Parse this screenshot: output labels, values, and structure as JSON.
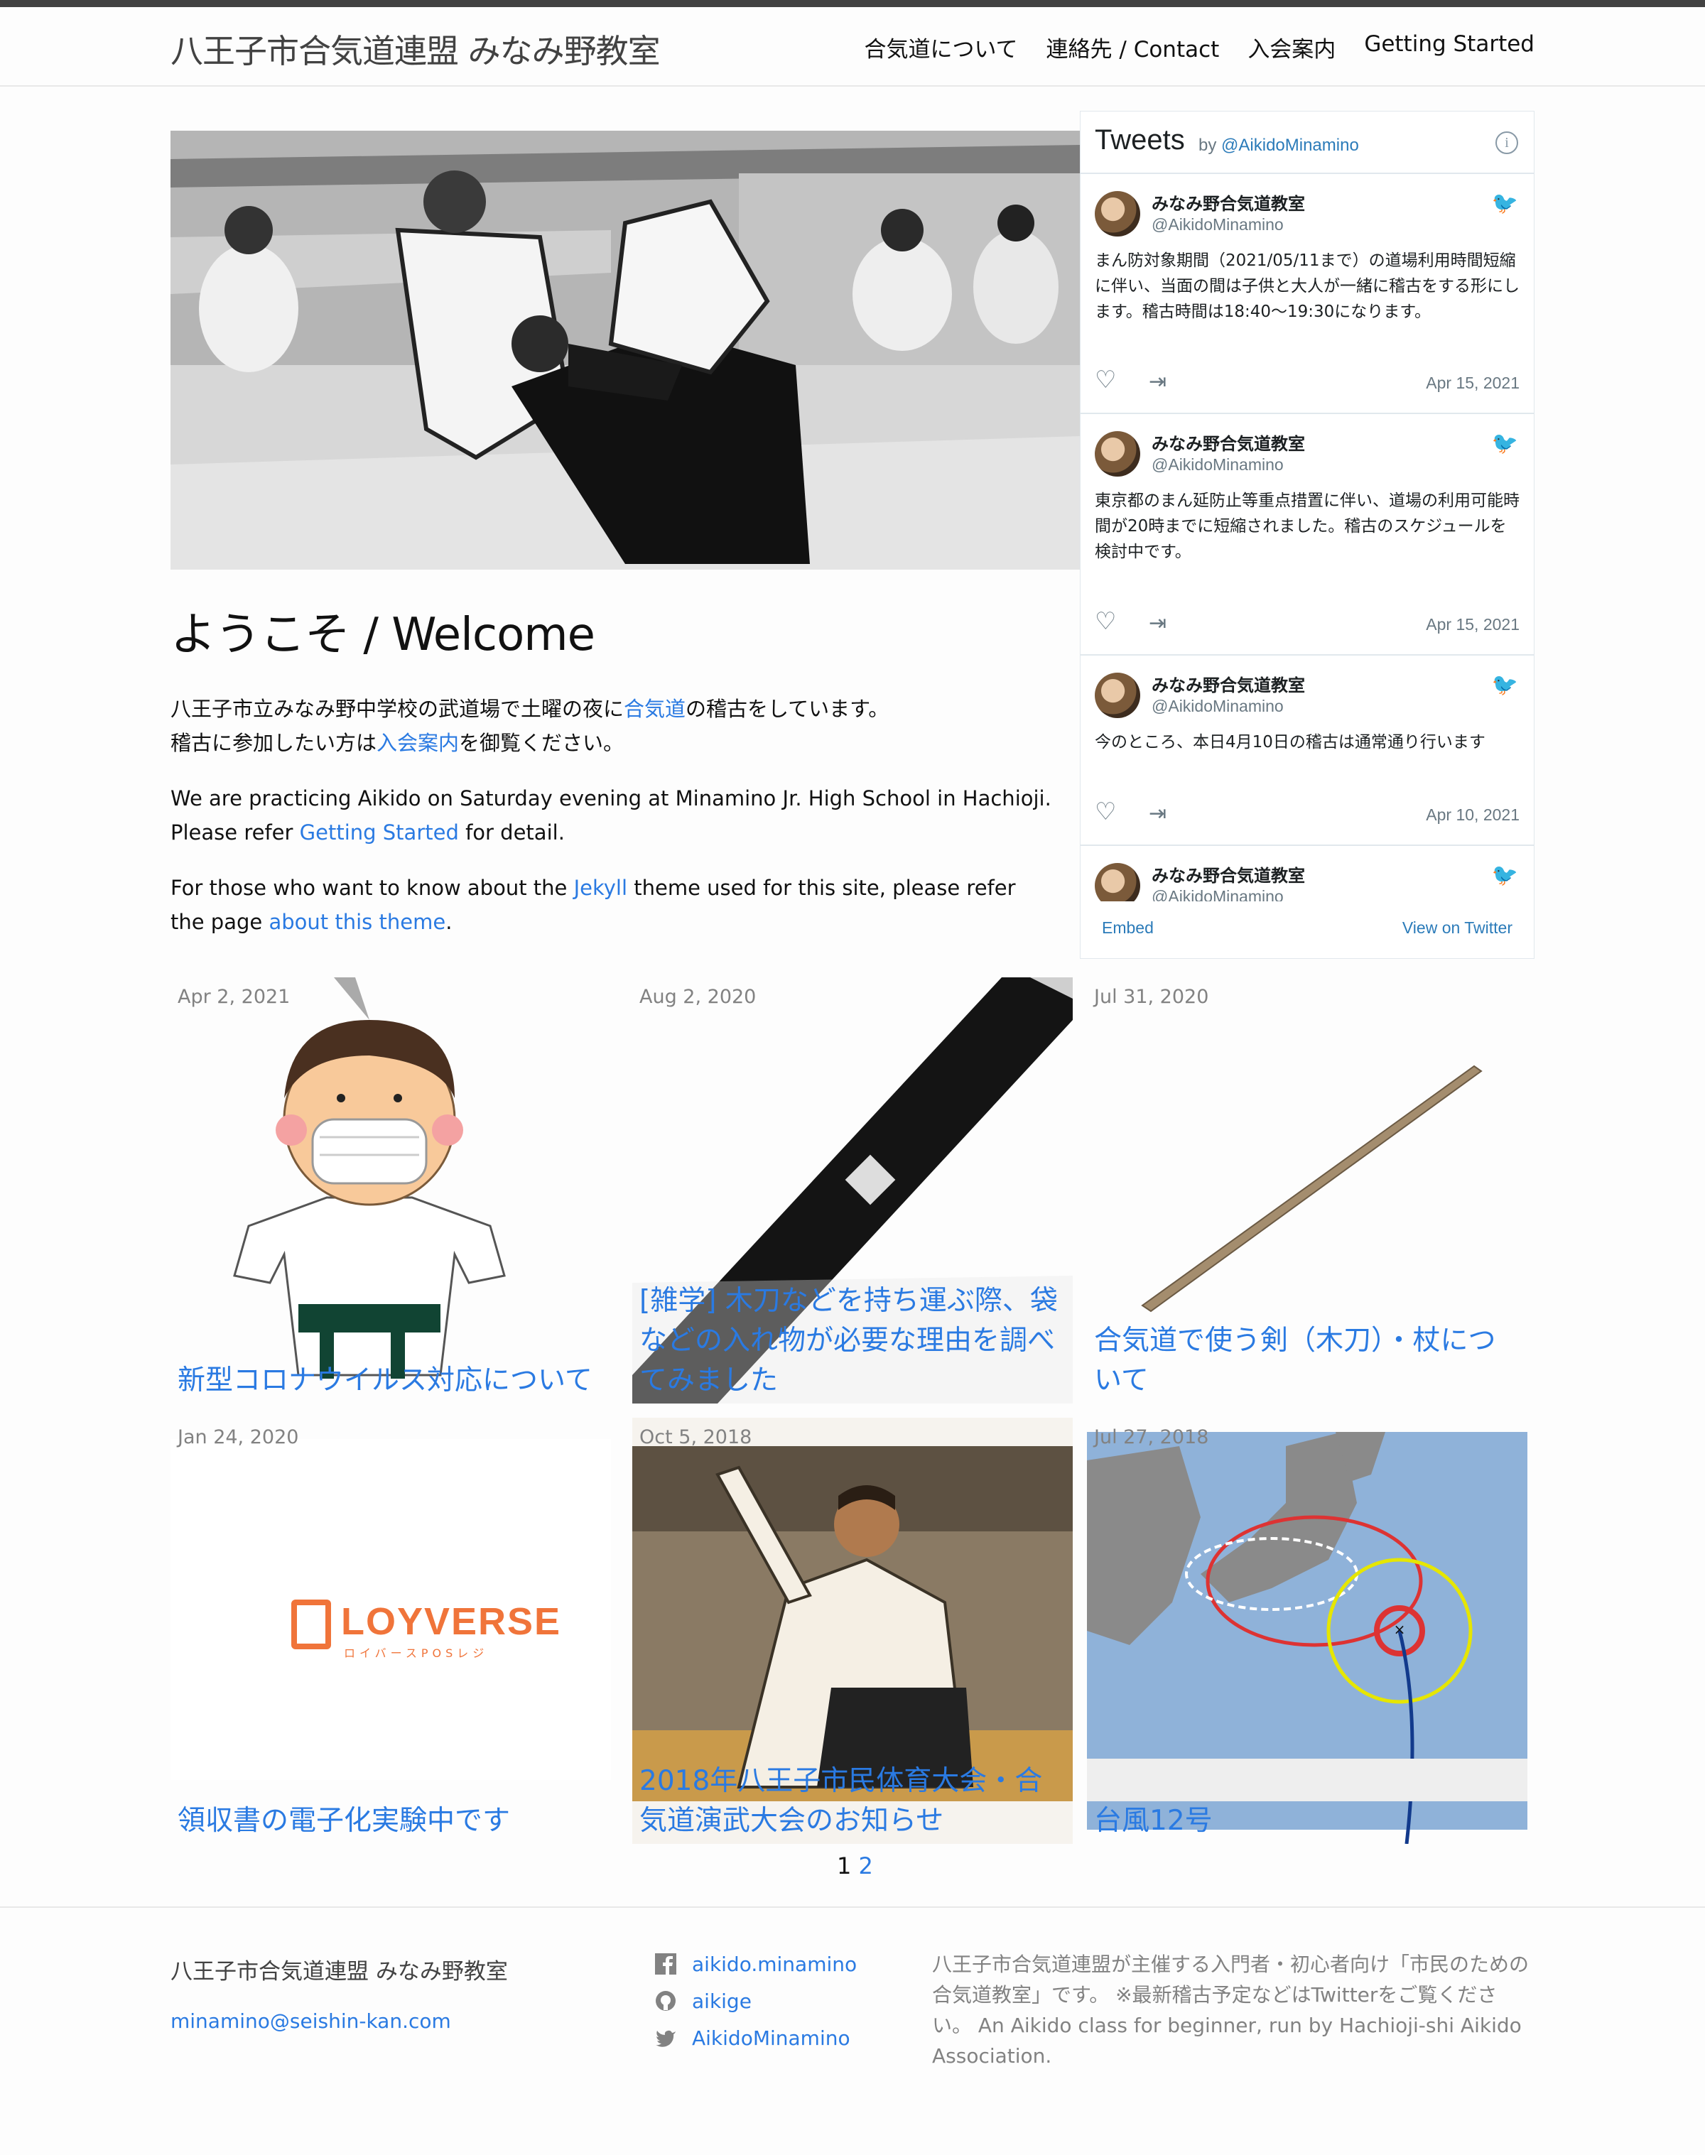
{
  "header": {
    "site_title": "八王子市合気道連盟 みなみ野教室",
    "nav": [
      "合気道について",
      "連絡先 / Contact",
      "入会案内",
      "Getting Started"
    ]
  },
  "welcome": {
    "heading": "ようこそ / Welcome",
    "p1_a": "八王子市立みなみ野中学校の武道場で土曜の夜に",
    "p1_link": "合気道",
    "p1_b": "の稽古をしています。",
    "p1_c": "稽古に参加したい方は",
    "p1_link2": "入会案内",
    "p1_d": "を御覧ください。",
    "p2_a": "We are practicing Aikido on Saturday evening at Minamino Jr. High School in Hachioji.",
    "p2_b": "Please refer ",
    "p2_link": "Getting Started",
    "p2_c": " for detail.",
    "p3_a": "For those who want to know about the ",
    "p3_link": "Jekyll",
    "p3_b": " theme used for this site, please refer the page ",
    "p3_link2": "about this theme",
    "p3_c": "."
  },
  "twitter": {
    "title": "Tweets",
    "by": "by",
    "handle_link": "@AikidoMinamino",
    "tweets": [
      {
        "name": "みなみ野合気道教室",
        "handle": "@AikidoMinamino",
        "text": "まん防対象期間（2021/05/11まで）の道場利用時間短縮に伴い、当面の間は子供と大人が一緒に稽古をする形にします。稽古時間は18:40～19:30になります。",
        "date": "Apr 15, 2021"
      },
      {
        "name": "みなみ野合気道教室",
        "handle": "@AikidoMinamino",
        "text": "東京都のまん延防止等重点措置に伴い、道場の利用可能時間が20時までに短縮されました。稽古のスケジュールを検討中です。",
        "date": "Apr 15, 2021"
      },
      {
        "name": "みなみ野合気道教室",
        "handle": "@AikidoMinamino",
        "text": "今のところ、本日4月10日の稽古は通常通り行います",
        "date": "Apr 10, 2021"
      },
      {
        "name": "みなみ野合気道教室",
        "handle": "@AikidoMinamino",
        "text": "",
        "date": ""
      }
    ],
    "embed": "Embed",
    "view": "View on Twitter"
  },
  "posts": [
    {
      "date": "Apr 2, 2021",
      "title": "新型コロナウイルス対応について"
    },
    {
      "date": "Aug 2, 2020",
      "title": "[雑学] 木刀などを持ち運ぶ際、袋などの入れ物が必要な理由を調べてみました"
    },
    {
      "date": "Jul 31, 2020",
      "title": "合気道で使う剣（木刀）・杖について"
    },
    {
      "date": "Jan 24, 2020",
      "title": "領収書の電子化実験中です"
    },
    {
      "date": "Oct 5, 2018",
      "title": "2018年八王子市民体育大会・合気道演武大会のお知らせ"
    },
    {
      "date": "Jul 27, 2018",
      "title": "台風12号"
    }
  ],
  "post_images": {
    "loyverse_logo": "LOYVERSE",
    "loyverse_sub": "ロイバースPOSレジ"
  },
  "pager": {
    "current": "1",
    "next": "2"
  },
  "footer": {
    "title": "八王子市合気道連盟 みなみ野教室",
    "email": "minamino@seishin-kan.com",
    "facebook": "aikido.minamino",
    "github": "aikige",
    "twitter": "AikidoMinamino",
    "description": "八王子市合気道連盟が主催する入門者・初心者向け「市民のための合気道教室」です。 ※最新稽古予定などはTwitterをご覧ください。 An Aikido class for beginner, run by Hachioji-shi Aikido Association."
  },
  "colors": {
    "link": "#2a7ae2",
    "muted": "#828282",
    "twitter_link": "#2b7bb9"
  }
}
